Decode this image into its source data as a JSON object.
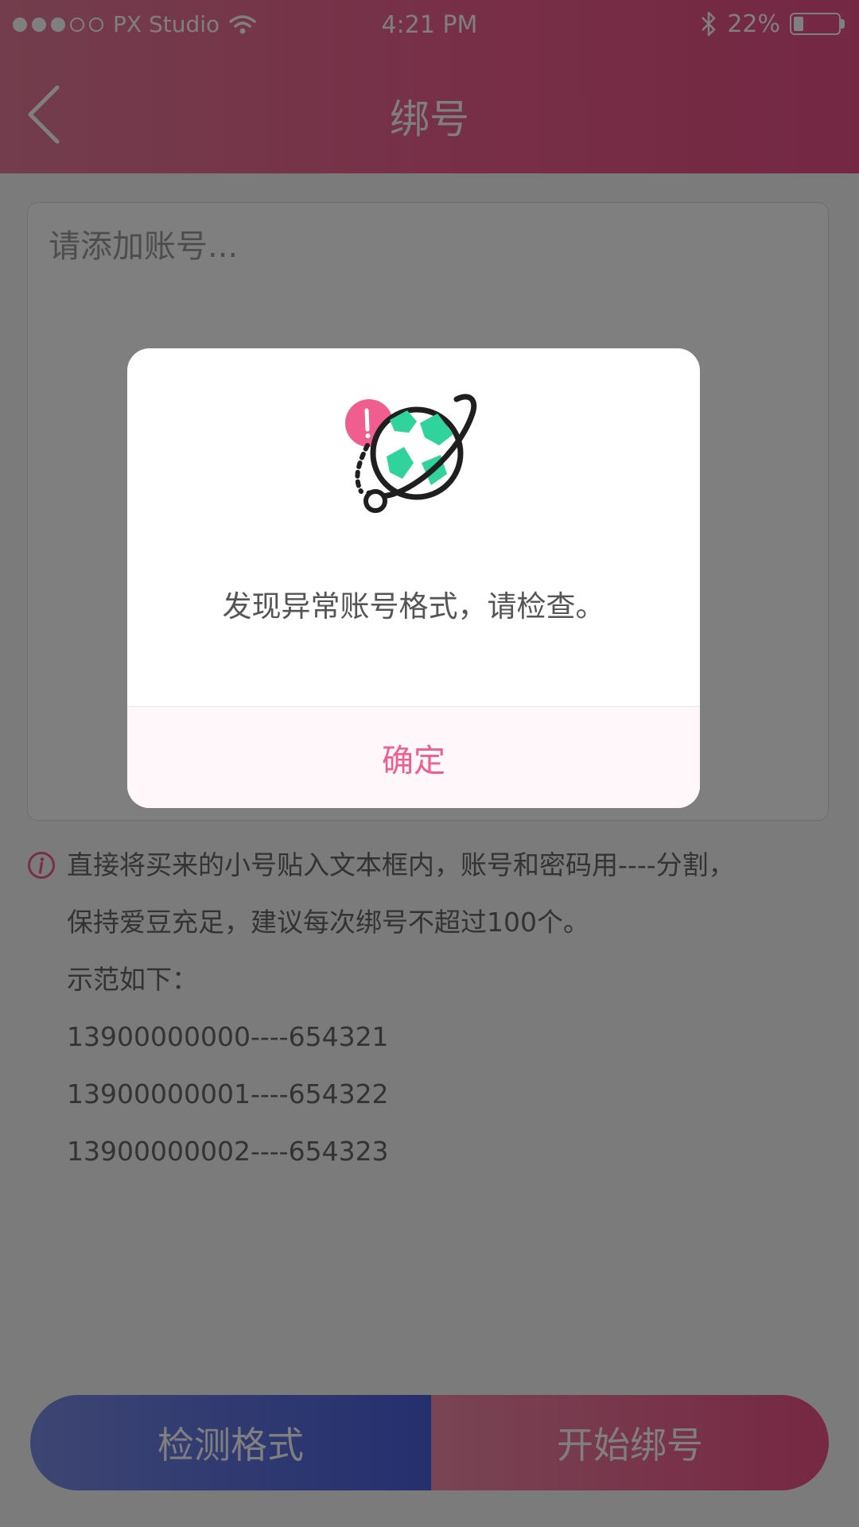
{
  "status_bar": {
    "carrier": "PX Studio",
    "time": "4:21 PM",
    "battery": "22%"
  },
  "header": {
    "title": "绑号"
  },
  "input": {
    "placeholder": "请添加账号..."
  },
  "instructions": {
    "lines": [
      "直接将买来的小号贴入文本框内，账号和密码用----分割，",
      "保持爱豆充足，建议每次绑号不超过100个。",
      "示范如下：",
      "13900000000----654321",
      "13900000001----654322",
      "13900000002----654323"
    ]
  },
  "buttons": {
    "check_format": "检测格式",
    "start_binding": "开始绑号"
  },
  "dialog": {
    "message": "发现异常账号格式，请检查。",
    "confirm": "确定"
  },
  "colors": {
    "header_gradient": [
      "#e67b9a",
      "#e84f86"
    ],
    "check_button": [
      "#7b8be6",
      "#4a5fdd"
    ],
    "bind_button": [
      "#f28aa8",
      "#ee4f86"
    ],
    "accent_pink": "#ee5e8f",
    "globe_green": "#2fd39b"
  },
  "icons": [
    "back-icon",
    "wifi-icon",
    "bluetooth-icon",
    "battery-icon",
    "info-icon",
    "globe-warning-icon"
  ]
}
